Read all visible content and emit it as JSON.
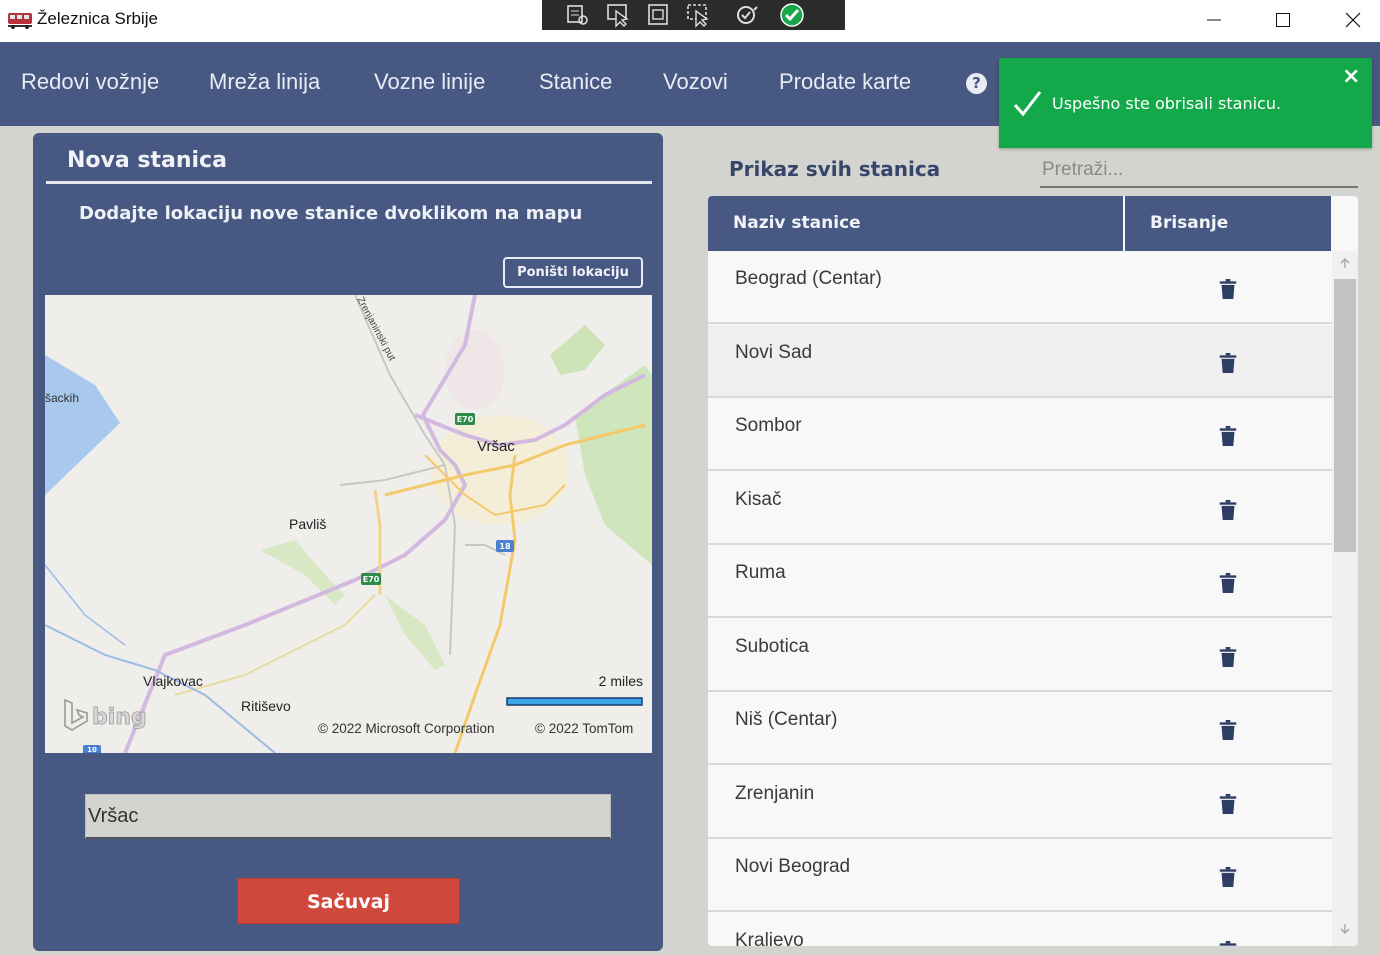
{
  "window": {
    "title": "Železnica Srbije",
    "icon": "train-icon",
    "controls": [
      "minimize-icon",
      "maximize-icon",
      "close-icon"
    ]
  },
  "debug_toolbar": [
    "live-visual-tree-icon",
    "select-element-icon",
    "display-layout-adorners-icon",
    "track-focus-icon",
    "hot-reload-icon",
    "check-icon"
  ],
  "nav": {
    "items": [
      "Redovi vožnje",
      "Mreža linija",
      "Vozne linije",
      "Stanice",
      "Vozovi",
      "Prodate karte"
    ],
    "help": "?"
  },
  "toast": {
    "message": "Uspešno ste obrisali stanicu.",
    "close": "×",
    "color": "#13a84a"
  },
  "new_station": {
    "title": "Nova stanica",
    "instruction": "Dodajte lokaciju nove stanice dvoklikom na mapu",
    "reset_button": "Poništi lokaciju",
    "location_value": "Vršac",
    "save_button": "Sačuvaj"
  },
  "map": {
    "labels": {
      "city": "Vršac",
      "village1": "Pavliš",
      "village2": "Vlajkovac",
      "village3": "Ritiševo",
      "water": "šackih",
      "road": "Zrenjaninski put"
    },
    "shields": [
      "E70",
      "E70",
      "18",
      "10"
    ],
    "scale": "2 miles",
    "copyright1": "© 2022 Microsoft Corporation",
    "copyright2": "© 2022 TomTom",
    "logo": "bing"
  },
  "stations": {
    "title": "Prikaz svih stanica",
    "search_placeholder": "Pretraži...",
    "columns": [
      "Naziv stanice",
      "Brisanje"
    ],
    "rows": [
      "Beograd (Centar)",
      "Novi Sad",
      "Sombor",
      "Kisač",
      "Ruma",
      "Subotica",
      "Niš (Centar)",
      "Zrenjanin",
      "Novi Beograd",
      "Kraljevo"
    ]
  },
  "colors": {
    "primary": "#475982",
    "accent_button": "#d0473c",
    "toast": "#13a84a",
    "background": "#d3d3cf"
  }
}
